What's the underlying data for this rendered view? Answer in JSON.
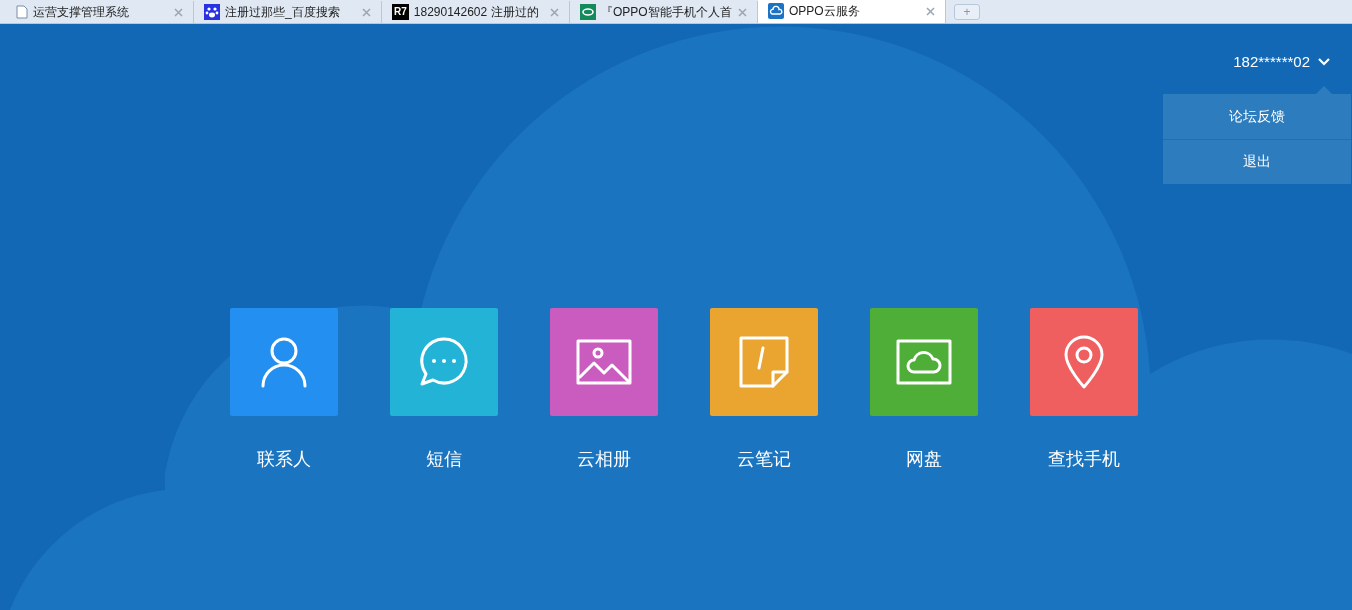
{
  "tabs": [
    {
      "label": "运营支撑管理系统",
      "kind": "doc",
      "selected": false
    },
    {
      "label": "注册过那些_百度搜索",
      "kind": "paw",
      "selected": false
    },
    {
      "label": "18290142602 注册过的",
      "kind": "badge",
      "badge": "R7",
      "selected": false
    },
    {
      "label": "『OPPO智能手机个人首",
      "kind": "ring",
      "selected": false
    },
    {
      "label": "OPPO云服务",
      "kind": "cloud",
      "selected": true
    }
  ],
  "new_tab": "+",
  "user": {
    "name": "182******02",
    "expanded": true,
    "menu": [
      "论坛反馈",
      "退出"
    ]
  },
  "apps": [
    {
      "label": "联系人",
      "kind": "person",
      "color": "#2390f1"
    },
    {
      "label": "短信",
      "kind": "chat",
      "color": "#22b3d6"
    },
    {
      "label": "云相册",
      "kind": "photo",
      "color": "#ca5cbf"
    },
    {
      "label": "云笔记",
      "kind": "note",
      "color": "#e9a530"
    },
    {
      "label": "网盘",
      "kind": "disk",
      "color": "#4eae38"
    },
    {
      "label": "查找手机",
      "kind": "pin",
      "color": "#ef5f5f"
    }
  ]
}
